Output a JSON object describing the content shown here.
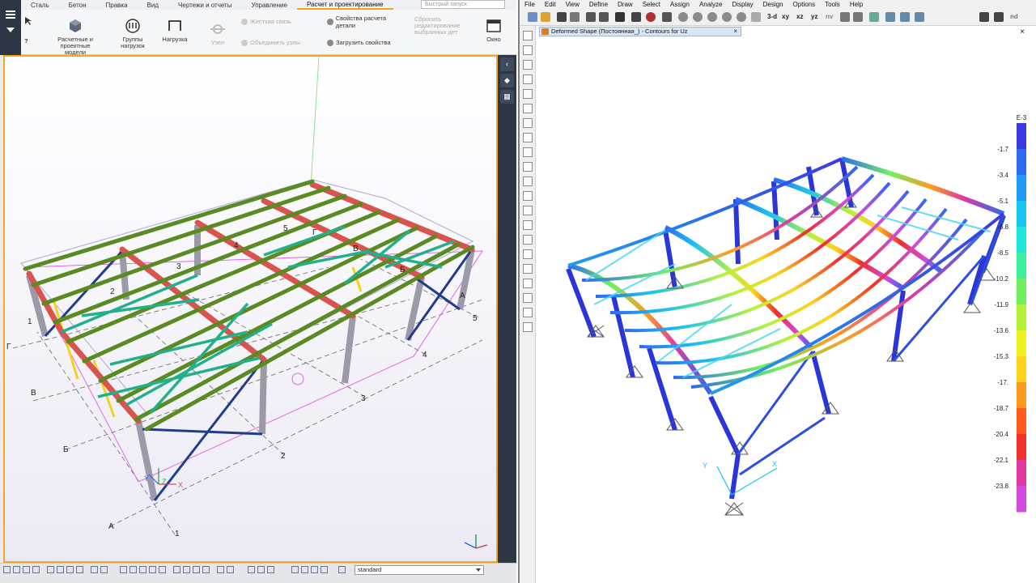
{
  "left_app": {
    "tabs": [
      "Сталь",
      "Бетон",
      "Правка",
      "Вид",
      "Чертежи и отчеты",
      "Управление",
      "Расчет и проектирование"
    ],
    "active_tab": "Расчет и проектирование",
    "quick_search_placeholder": "Быстрый запуск",
    "ribbon": {
      "analysis_models": "Расчетные и проектные модели",
      "load_groups": "Группы нагрузок",
      "load": "Нагрузка",
      "node": "Узел",
      "rigid_link": "Жесткая связь",
      "combine_nodes": "Объединить узлы",
      "part_props": "Свойства расчета детали",
      "load_props": "Загрузить свойства",
      "edit_selected": "Сбросить редактирование выбранных дет",
      "window": "Окно"
    },
    "grid_labels": {
      "numbers": [
        "1",
        "2",
        "3",
        "4",
        "5"
      ],
      "letters": [
        "А",
        "Б",
        "В",
        "Г"
      ],
      "model_numbers": [
        "2",
        "3",
        "4",
        "5"
      ],
      "model_letters": [
        "Г",
        "В",
        "Б",
        "А"
      ]
    },
    "axis_labels": {
      "x": "X",
      "y": "Y",
      "z": "Z"
    },
    "view_select": "standard"
  },
  "right_app": {
    "menu": [
      "File",
      "Edit",
      "View",
      "Define",
      "Draw",
      "Select",
      "Assign",
      "Analyze",
      "Display",
      "Design",
      "Options",
      "Tools",
      "Help"
    ],
    "toolbar_text": [
      "3-d",
      "xy",
      "xz",
      "yz",
      "nv",
      "nd"
    ],
    "doc_tab_title": "Deformed Shape (Постоянная_) - Contours for Uz",
    "legend_exp": "E-3",
    "legend_values": [
      "-1.7",
      "-3.4",
      "-5.1",
      "-6.8",
      "-8.5",
      "-10.2",
      "-11.9",
      "-13.6",
      "-15.3",
      "-17.",
      "-18.7",
      "-20.4",
      "-22.1",
      "-23.8"
    ],
    "legend_colors": [
      "#3a3ae0",
      "#2d6af0",
      "#1f9bf5",
      "#19c4f0",
      "#1fe8d8",
      "#3cf0a0",
      "#70f060",
      "#b4f23a",
      "#eef21e",
      "#ffd21e",
      "#ff9a1e",
      "#ff5a1e",
      "#f0302a",
      "#e03aa0",
      "#d04ae0"
    ],
    "axis_labels": {
      "x": "X",
      "y": "Y"
    }
  },
  "colors": {
    "tekla_accent": "#f5a623",
    "tekla_dark": "#2c3645",
    "beam_green": "#5a8a22",
    "beam_red": "#d9534f",
    "brace_teal": "#22b08a",
    "column_grey": "#9a9aa8",
    "brace_navy": "#1f3d8a",
    "brace_yellow": "#f2d21b"
  }
}
